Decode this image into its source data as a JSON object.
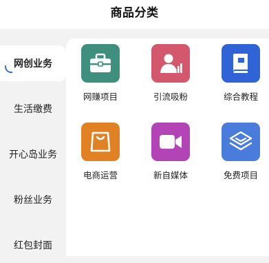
{
  "header": {
    "title": "商品分类"
  },
  "sidebar": {
    "items": [
      {
        "label": "网创业务",
        "active": true
      },
      {
        "label": "生活缴费",
        "active": false
      },
      {
        "label": "开心岛业务",
        "active": false
      },
      {
        "label": "粉丝业务",
        "active": false
      },
      {
        "label": "红包封面",
        "active": false
      }
    ]
  },
  "grid": {
    "items": [
      {
        "label": "网赚项目",
        "icon": "briefcase-icon",
        "color": "#3f8f7e"
      },
      {
        "label": "引流吸粉",
        "icon": "user-chart-icon",
        "color": "#d4586d"
      },
      {
        "label": "综合教程",
        "icon": "book-icon",
        "color": "#2f63d6"
      },
      {
        "label": "电商运营",
        "icon": "shopping-bag-icon",
        "color": "#e08223"
      },
      {
        "label": "新自媒体",
        "icon": "video-camera-icon",
        "color": "#b344b5"
      },
      {
        "label": "免费项目",
        "icon": "layers-icon",
        "color": "#4a7cdc"
      }
    ]
  }
}
